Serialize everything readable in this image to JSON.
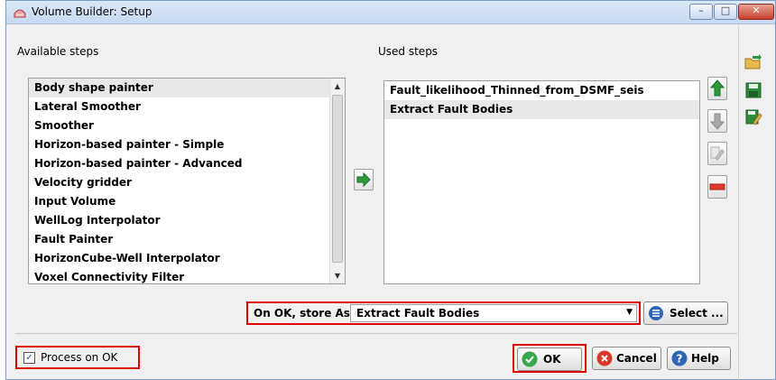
{
  "window": {
    "title": "Volume Builder: Setup",
    "controls": {
      "minimize": "–",
      "maximize": "□",
      "close": "✕"
    }
  },
  "available": {
    "label": "Available steps",
    "items": [
      "Body shape painter",
      "Lateral Smoother",
      "Smoother",
      "Horizon-based painter - Simple",
      "Horizon-based painter - Advanced",
      "Velocity gridder",
      "Input Volume",
      "WellLog Interpolator",
      "Fault Painter",
      "HorizonCube-Well Interpolator",
      "Voxel Connectivity Filter"
    ],
    "selected_index": 0
  },
  "used": {
    "label": "Used steps",
    "items": [
      "Fault_likelihood_Thinned_from_DSMF_seis",
      "Extract Fault Bodies"
    ],
    "selected_index": 1
  },
  "store": {
    "label": "On OK, store As",
    "value": "Extract Fault Bodies",
    "select_label": "Select ..."
  },
  "footer": {
    "process_label": "Process on OK",
    "process_checked": true,
    "ok_label": "OK",
    "cancel_label": "Cancel",
    "help_label": "Help"
  },
  "icons": {
    "add_arrow": "right-arrow-icon",
    "move_up": "up-arrow-icon",
    "move_down": "down-arrow-icon",
    "edit": "edit-step-icon",
    "remove": "remove-icon",
    "open": "open-folder-icon",
    "save": "save-icon",
    "save_as": "save-as-icon"
  },
  "colors": {
    "highlight": "#e00000",
    "green_arrow": "#2e9b3a",
    "remove_red": "#e0392b",
    "ok_green": "#3aa64a",
    "cancel_red": "#d83a2a",
    "help_blue": "#2f67b7"
  }
}
